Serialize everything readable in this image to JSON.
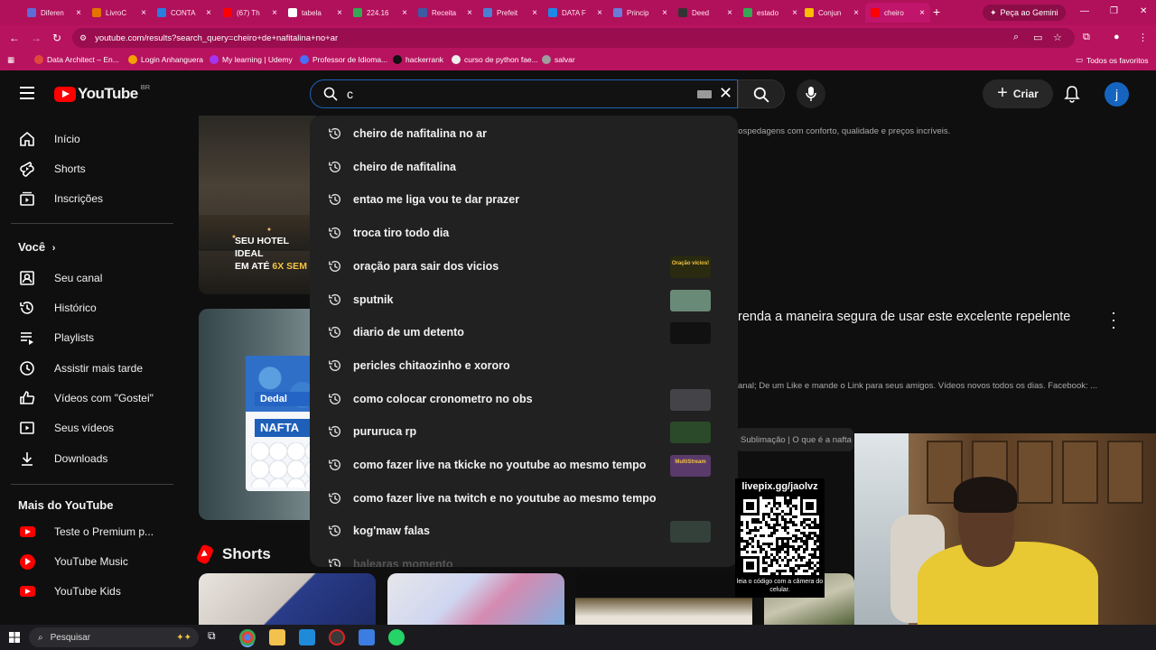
{
  "browser": {
    "tabs": [
      {
        "title": "Diferen",
        "color": "#5f6bd6"
      },
      {
        "title": "LivroC",
        "color": "#e37400"
      },
      {
        "title": "CONTA",
        "color": "#2a7de1"
      },
      {
        "title": "(67) Th",
        "color": "#ff0000"
      },
      {
        "title": "tabela",
        "color": "#ffffff"
      },
      {
        "title": "224.16",
        "color": "#34a853"
      },
      {
        "title": "Receita",
        "color": "#3b5ba5"
      },
      {
        "title": "Prefeit",
        "color": "#4a7fd4"
      },
      {
        "title": "DATA F",
        "color": "#1e88e5"
      },
      {
        "title": "Princip",
        "color": "#6a7bd8"
      },
      {
        "title": "Deed",
        "color": "#333333"
      },
      {
        "title": "estado",
        "color": "#34a853"
      },
      {
        "title": "Conjun",
        "color": "#fbbc04"
      },
      {
        "title": "cheiro",
        "color": "#ff0000"
      }
    ],
    "gemini_label": "Peça ao Gemini",
    "url": "youtube.com/results?search_query=cheiro+de+nafitalina+no+ar",
    "bookmarks": [
      {
        "label": "Data Architect – En...",
        "color": "#e04a3a"
      },
      {
        "label": "Login Anhanguera",
        "color": "#f4a000"
      },
      {
        "label": "My learning | Udemy",
        "color": "#a435f0"
      },
      {
        "label": "Professor de Idioma...",
        "color": "#4b6ef5"
      },
      {
        "label": "hackerrank",
        "color": "#111111"
      },
      {
        "label": "curso de python fae...",
        "color": "#eeeeee"
      },
      {
        "label": "salvar",
        "color": "#9e9e9e"
      }
    ],
    "bookmarks_all": "Todos os favoritos"
  },
  "youtube": {
    "logo_word": "YouTube",
    "country": "BR",
    "search_value": "c",
    "create_label": "Criar",
    "avatar_letter": "j"
  },
  "sidebar": {
    "main": [
      {
        "label": "Início",
        "icon": "home-icon"
      },
      {
        "label": "Shorts",
        "icon": "shorts-icon"
      },
      {
        "label": "Inscrições",
        "icon": "subscriptions-icon"
      }
    ],
    "you_title": "Você",
    "you": [
      {
        "label": "Seu canal",
        "icon": "channel-icon"
      },
      {
        "label": "Histórico",
        "icon": "history-icon"
      },
      {
        "label": "Playlists",
        "icon": "playlists-icon"
      },
      {
        "label": "Assistir mais tarde",
        "icon": "watch-later-icon"
      },
      {
        "label": "Vídeos com \"Gostei\"",
        "icon": "like-icon"
      },
      {
        "label": "Seus vídeos",
        "icon": "your-videos-icon"
      },
      {
        "label": "Downloads",
        "icon": "download-icon"
      }
    ],
    "more_title": "Mais do YouTube",
    "more": [
      {
        "label": "Teste o Premium p...",
        "icon": "youtube-premium-icon"
      },
      {
        "label": "YouTube Music",
        "icon": "youtube-music-icon"
      },
      {
        "label": "YouTube Kids",
        "icon": "youtube-kids-icon"
      }
    ]
  },
  "suggestions": [
    {
      "label": "cheiro de nafitalina no ar",
      "thumb": null
    },
    {
      "label": "cheiro de nafitalina",
      "thumb": null
    },
    {
      "label": "entao me liga vou te dar prazer",
      "thumb": null
    },
    {
      "label": "troca tiro todo dia",
      "thumb": null
    },
    {
      "label": "oração para sair dos vicios",
      "thumb": "#2a2a10",
      "thumb_text": "Oração vícios!"
    },
    {
      "label": "sputnik",
      "thumb": "#6a8a78"
    },
    {
      "label": "diario de um detento",
      "thumb": "#111111"
    },
    {
      "label": "pericles chitaozinho e xororo",
      "thumb": null
    },
    {
      "label": "como colocar cronometro no obs",
      "thumb": "#444448"
    },
    {
      "label": "pururuca rp",
      "thumb": "#2a4a2a"
    },
    {
      "label": "como fazer live na tkicke no youtube ao mesmo tempo",
      "thumb": "#5a3a6a",
      "thumb_text": "MultiStream"
    },
    {
      "label": "como fazer live na twitch e no youtube ao mesmo tempo",
      "thumb": null
    },
    {
      "label": "kog'maw falas",
      "thumb": "#34403a"
    },
    {
      "label": "balearas momento",
      "thumb": null
    }
  ],
  "results": {
    "ad_desc": "hospedagens com conforto, qualidade e preços incríveis.",
    "ad_thumb_line1": "SEU HOTEL IDEAL",
    "ad_thumb_line2_prefix": "EM ATÉ ",
    "ad_thumb_line2_highlight": "6X SEM J",
    "video_brand": "Dedal",
    "video_brand_word": "NAFTA",
    "video_title": "renda a maneira segura de usar este excelente repelente",
    "video_desc": "anal; De um Like e mande o Link para seus amigos. Vídeos novos todos os dias. Facebook: ...",
    "chapter": "Sublimação | O que é a nafta",
    "shorts_title": "Shorts"
  },
  "overlay": {
    "qr_caption": "livepix.gg/jaolvz",
    "qr_note": "leia o código com a câmera do celular."
  },
  "taskbar": {
    "search_placeholder": "Pesquisar"
  }
}
